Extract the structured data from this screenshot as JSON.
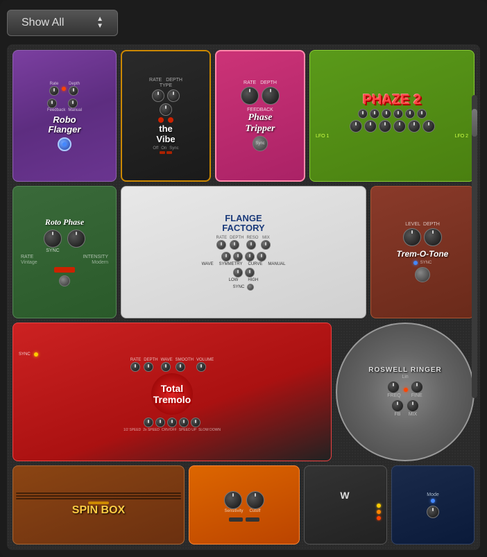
{
  "toolbar": {
    "show_all_label": "Show All",
    "dropdown_up": "▲",
    "dropdown_down": "▼"
  },
  "pedals": {
    "row1": [
      {
        "id": "robo-flanger",
        "name": "Robo Flanger",
        "type": "flanger",
        "color_scheme": "purple",
        "knobs": [
          "Rate",
          "Depth",
          "Feedback",
          "Manual"
        ]
      },
      {
        "id": "the-vibe",
        "name": "the Vibe",
        "type": "chorus",
        "color_scheme": "dark-orange",
        "knobs": [
          "Rate",
          "Depth",
          "Type"
        ]
      },
      {
        "id": "phase-tripper",
        "name": "Phase Tripper",
        "type": "phaser",
        "color_scheme": "pink",
        "knobs": [
          "Rate",
          "Depth",
          "Feedback"
        ]
      },
      {
        "id": "phaze2",
        "name": "PHAZE 2",
        "type": "phaser",
        "color_scheme": "green",
        "labels": [
          "LFO 1",
          "LFO 2"
        ]
      }
    ],
    "row2": [
      {
        "id": "roto-phase",
        "name": "Roto Phase",
        "type": "phaser",
        "color_scheme": "teal",
        "knobs": [
          "Rate",
          "Intensity"
        ]
      },
      {
        "id": "flange-factory",
        "name": "FLANGE FACTORY",
        "type": "flanger",
        "color_scheme": "white",
        "knobs": [
          "Rate",
          "Depth",
          "Reso",
          "Mix"
        ]
      },
      {
        "id": "trem-o-tone",
        "name": "Trem-O-Tone",
        "type": "tremolo",
        "color_scheme": "dark-red"
      }
    ],
    "row3": [
      {
        "id": "total-tremolo",
        "name": "Total Tremolo",
        "type": "tremolo",
        "color_scheme": "red-black",
        "knobs": [
          "Rate",
          "Depth",
          "Wave",
          "Smooth",
          "Volume"
        ]
      },
      {
        "id": "roswell-ringer",
        "name": "ROSWELL RINGER",
        "type": "ring-mod",
        "color_scheme": "silver",
        "knobs": [
          "Freq",
          "Fine",
          "FB",
          "Mix"
        ]
      }
    ],
    "row4": [
      {
        "id": "spin-box",
        "name": "SPIN BOX",
        "type": "rotary",
        "color_scheme": "wood"
      },
      {
        "id": "orange-pedal",
        "name": "",
        "type": "unknown",
        "color_scheme": "orange",
        "knobs": [
          "Sensitivity",
          "Cutoff"
        ]
      },
      {
        "id": "dark-pedal",
        "name": "",
        "type": "unknown",
        "color_scheme": "dark"
      },
      {
        "id": "navy-pedal",
        "name": "",
        "type": "unknown",
        "color_scheme": "navy",
        "labels": [
          "Mode"
        ]
      }
    ]
  }
}
